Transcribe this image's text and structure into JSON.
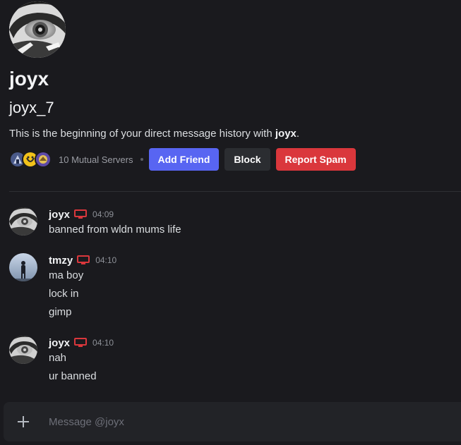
{
  "profile": {
    "display_name": "joyx",
    "username": "joyx_7",
    "beginning_prefix": "This is the beginning of your direct message history with ",
    "beginning_name": "joyx",
    "beginning_suffix": ".",
    "mutual_servers": "10 Mutual Servers"
  },
  "actions": {
    "add_friend": "Add Friend",
    "block": "Block",
    "report_spam": "Report Spam"
  },
  "messages": [
    {
      "author": "joyx",
      "time": "04:09",
      "device_icon": "desktop-icon",
      "lines": [
        "banned from wldn mums life"
      ]
    },
    {
      "author": "tmzy",
      "time": "04:10",
      "device_icon": "desktop-icon",
      "lines": [
        "ma boy",
        "lock in",
        "gimp"
      ]
    },
    {
      "author": "joyx",
      "time": "04:10",
      "device_icon": "desktop-icon",
      "lines": [
        "nah",
        "ur banned"
      ]
    }
  ],
  "composer": {
    "placeholder": "Message @joyx",
    "plus_icon": "plus-icon"
  },
  "colors": {
    "background": "#1a1a1e",
    "blurple": "#5865f2",
    "danger": "#da373c",
    "device_icon": "#da373c"
  }
}
